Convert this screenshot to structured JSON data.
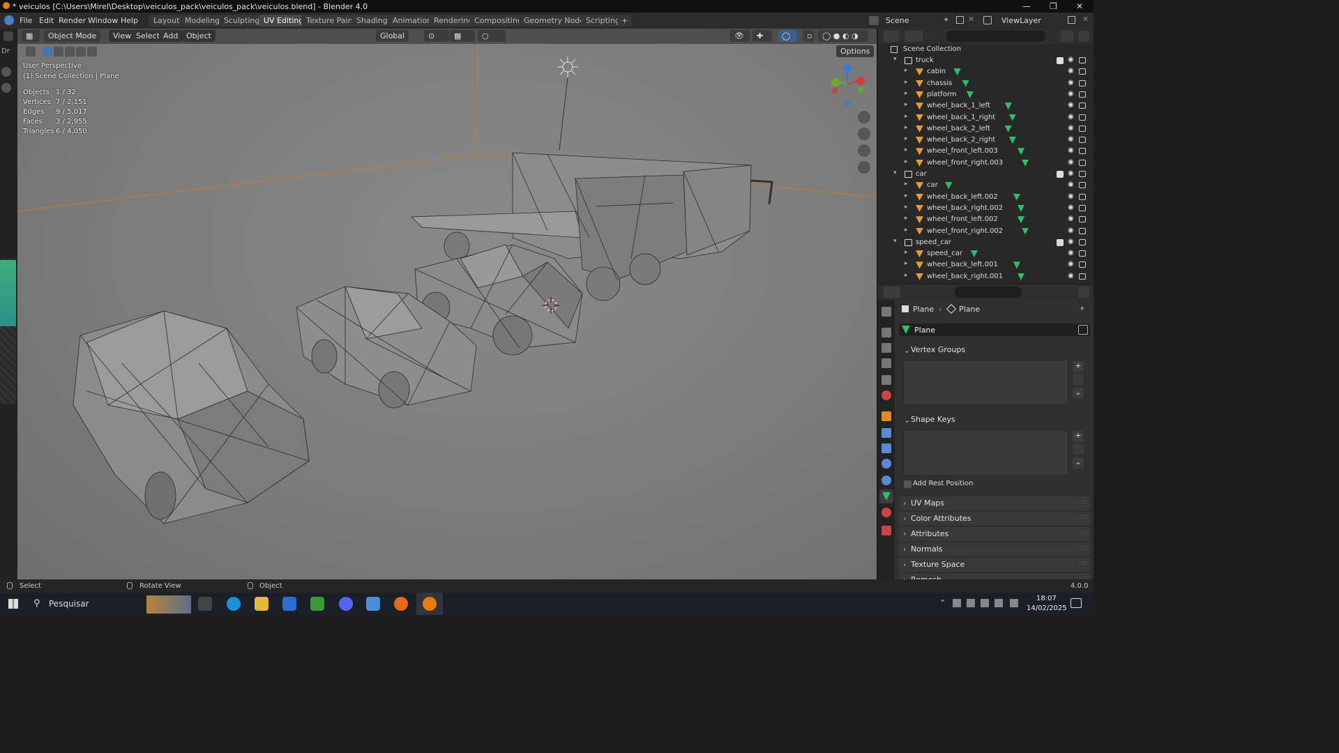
{
  "window": {
    "title": "* veiculos [C:\\Users\\Mirel\\Desktop\\veiculos_pack\\veiculos_pack\\veiculos.blend] - Blender 4.0"
  },
  "menu": [
    "File",
    "Edit",
    "Render",
    "Window",
    "Help"
  ],
  "workspaces": [
    "Layout",
    "Modeling",
    "Sculpting",
    "UV Editing",
    "Texture Paint",
    "Shading",
    "Animation",
    "Rendering",
    "Compositing",
    "Geometry Nodes",
    "Scripting"
  ],
  "active_workspace": "UV Editing",
  "scene": {
    "label": "Scene",
    "view_layer": "ViewLayer"
  },
  "viewport_header": {
    "mode": "Object Mode",
    "view": "View",
    "select": "Select",
    "add": "Add",
    "object": "Object",
    "orientation": "Global",
    "options": "Options"
  },
  "overlay": {
    "perspective": "User Perspective",
    "collection": "(1) Scene Collection | Plane"
  },
  "stats": [
    {
      "k": "Objects",
      "v": "1 / 32"
    },
    {
      "k": "Vertices",
      "v": "7 / 2,151"
    },
    {
      "k": "Edges",
      "v": "9 / 5,017"
    },
    {
      "k": "Faces",
      "v": "3 / 2,955"
    },
    {
      "k": "Triangles",
      "v": "6 / 4,050"
    }
  ],
  "outliner": {
    "root": "Scene Collection",
    "rows": [
      {
        "name": "truck",
        "kind": "collection"
      },
      {
        "name": "cabin",
        "kind": "object"
      },
      {
        "name": "chassis",
        "kind": "object"
      },
      {
        "name": "platform",
        "kind": "object"
      },
      {
        "name": "wheel_back_1_left",
        "kind": "object"
      },
      {
        "name": "wheel_back_1_right",
        "kind": "object"
      },
      {
        "name": "wheel_back_2_left",
        "kind": "object"
      },
      {
        "name": "wheel_back_2_right",
        "kind": "object"
      },
      {
        "name": "wheel_front_left.003",
        "kind": "object"
      },
      {
        "name": "wheel_front_right.003",
        "kind": "object"
      },
      {
        "name": "car",
        "kind": "collection"
      },
      {
        "name": "car",
        "kind": "object"
      },
      {
        "name": "wheel_back_left.002",
        "kind": "object"
      },
      {
        "name": "wheel_back_right.002",
        "kind": "object"
      },
      {
        "name": "wheel_front_left.002",
        "kind": "object"
      },
      {
        "name": "wheel_front_right.002",
        "kind": "object"
      },
      {
        "name": "speed_car",
        "kind": "collection"
      },
      {
        "name": "speed_car",
        "kind": "object"
      },
      {
        "name": "wheel_back_left.001",
        "kind": "object"
      },
      {
        "name": "wheel_back_right.001",
        "kind": "object"
      }
    ]
  },
  "properties": {
    "breadcrumb_obj": "Plane",
    "breadcrumb_data": "Plane",
    "data_name": "Plane",
    "vertex_groups": "Vertex Groups",
    "shape_keys": "Shape Keys",
    "add_rest_position": "Add Rest Position",
    "collapsed": [
      "UV Maps",
      "Color Attributes",
      "Attributes",
      "Normals",
      "Texture Space",
      "Remesh"
    ]
  },
  "status": {
    "select": "Select",
    "rotate": "Rotate View",
    "object": "Object",
    "version": "4.0.0"
  },
  "taskbar": {
    "search": "Pesquisar",
    "time": "18:07",
    "date": "14/02/2025"
  }
}
